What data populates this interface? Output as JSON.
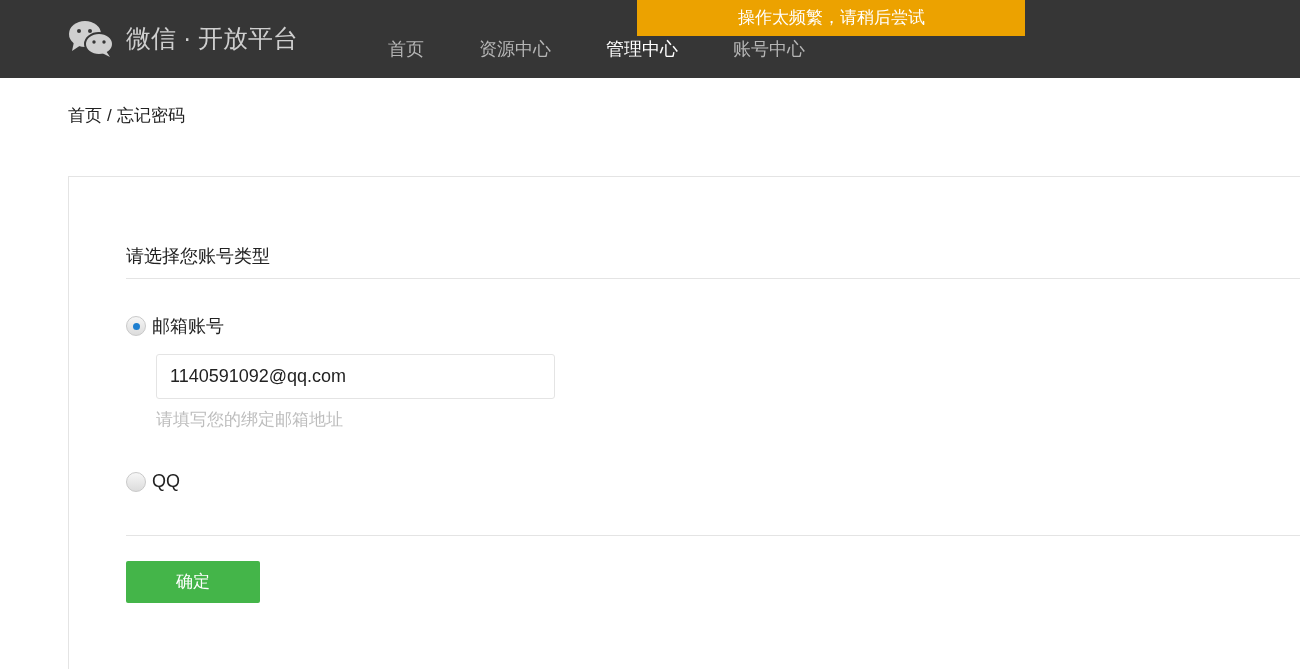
{
  "header": {
    "logo_text": "微信 · 开放平台",
    "nav": [
      {
        "label": "首页",
        "selected": false
      },
      {
        "label": "资源中心",
        "selected": false
      },
      {
        "label": "管理中心",
        "selected": true
      },
      {
        "label": "账号中心",
        "selected": false
      }
    ]
  },
  "toast": "操作太频繁，请稍后尝试",
  "breadcrumb": {
    "items": [
      "首页",
      "忘记密码"
    ],
    "separator": "/"
  },
  "form": {
    "title": "请选择您账号类型",
    "options": [
      {
        "label": "邮箱账号",
        "selected": true,
        "value": "1140591092@qq.com",
        "hint": "请填写您的绑定邮箱地址"
      },
      {
        "label": "QQ",
        "selected": false
      }
    ],
    "submit": "确定"
  }
}
